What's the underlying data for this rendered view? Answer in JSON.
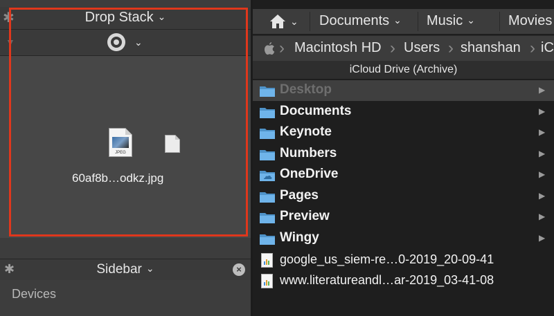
{
  "drop_stack": {
    "title": "Drop Stack",
    "file_name": "60af8b…odkz.jpg",
    "jpeg_label": "JPEG"
  },
  "sidebar": {
    "title": "Sidebar",
    "section": "Devices"
  },
  "favorites": {
    "items": [
      "Documents",
      "Music",
      "Movies"
    ]
  },
  "path": {
    "items": [
      "Macintosh HD",
      "Users",
      "shanshan",
      "iC"
    ]
  },
  "list": {
    "header": "iCloud Drive (Archive)",
    "folders": [
      "Desktop",
      "Documents",
      "Keynote",
      "Numbers",
      "OneDrive",
      "Pages",
      "Preview",
      "Wingy"
    ],
    "files": [
      "google_us_siem-re…0-2019_20-09-41",
      "www.literatureandl…ar-2019_03-41-08"
    ]
  },
  "colors": {
    "highlight": "#e0371c",
    "folder": "#5aa9e6"
  },
  "icons": [
    "gear-icon",
    "chevron-down-icon",
    "target-icon",
    "triangle-icon",
    "close-icon",
    "home-icon",
    "apple-icon",
    "folder-icon",
    "cloud-folder-icon",
    "chart-document-icon",
    "jpeg-file-icon",
    "document-file-icon",
    "disclosure-arrow-icon"
  ]
}
